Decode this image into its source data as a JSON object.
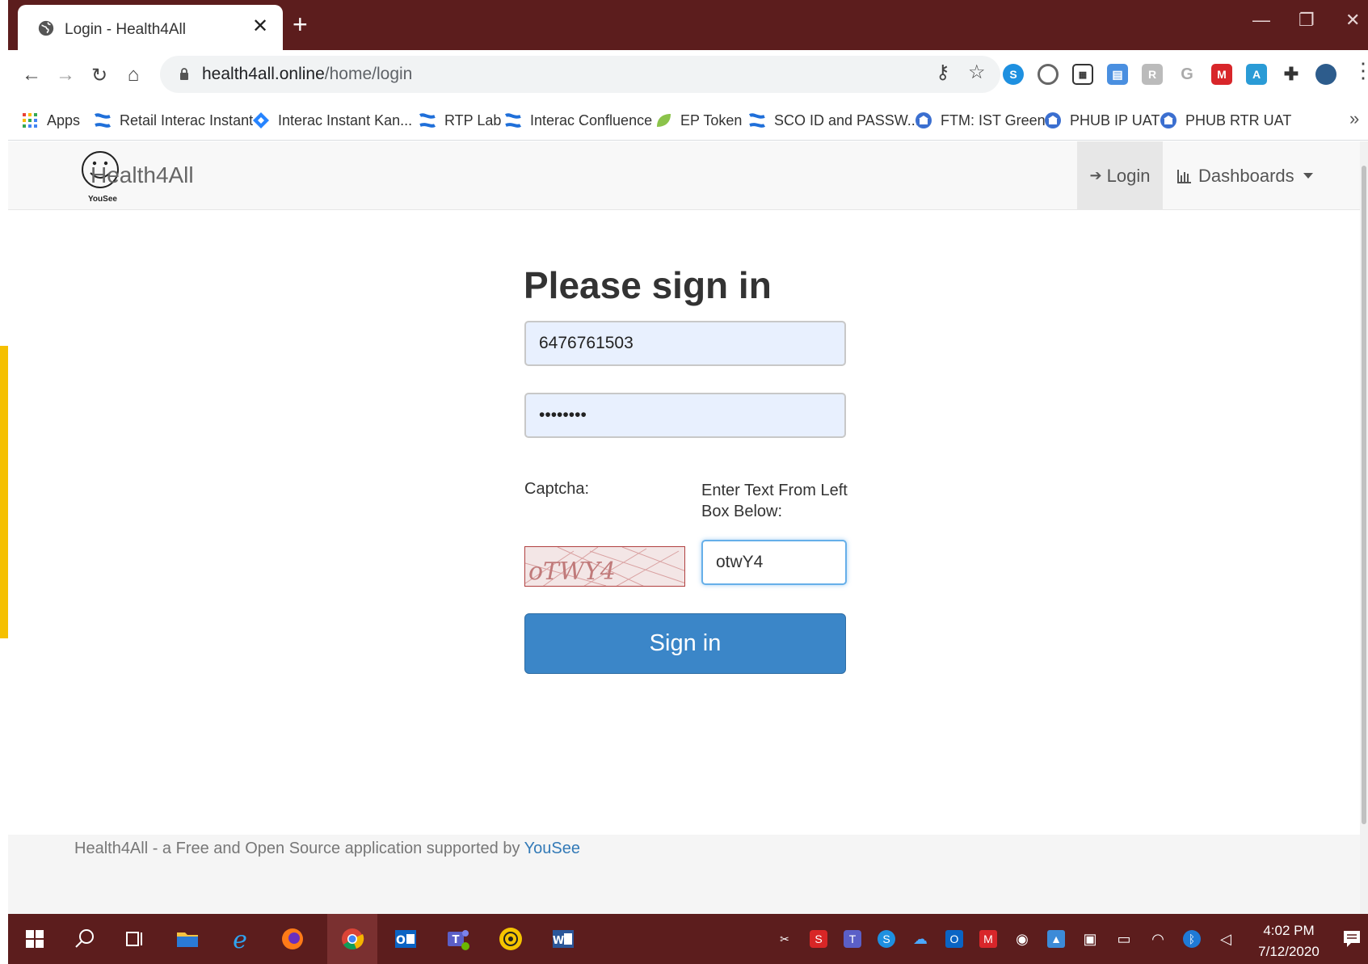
{
  "browser": {
    "tab": {
      "title": "Login - Health4All",
      "icon": "globe-icon"
    },
    "new_tab": "+",
    "window_controls": {
      "minimize": "—",
      "restore": "❐",
      "close": "✕"
    },
    "url": {
      "host": "health4all.online",
      "path": "/home/login"
    },
    "bookmarks": [
      {
        "label": "Apps",
        "icon": "apps-grid-icon"
      },
      {
        "label": "Retail Interac Instant",
        "icon": "confluence-icon"
      },
      {
        "label": "Interac Instant Kan...",
        "icon": "jira-icon"
      },
      {
        "label": "RTP Lab",
        "icon": "confluence-icon"
      },
      {
        "label": "Interac Confluence",
        "icon": "confluence-icon"
      },
      {
        "label": "EP Token",
        "icon": "leaf-icon"
      },
      {
        "label": "SCO ID and PASSW...",
        "icon": "confluence-icon"
      },
      {
        "label": "FTM: IST Green",
        "icon": "bank-icon"
      },
      {
        "label": "PHUB IP UAT",
        "icon": "bank-icon"
      },
      {
        "label": "PHUB RTR UAT",
        "icon": "bank-icon"
      }
    ],
    "bookmarks_more": "»"
  },
  "site": {
    "brand": "Health4All",
    "brand_sub": "YouSee",
    "nav": {
      "login": "Login",
      "dashboards": "Dashboards"
    }
  },
  "form": {
    "heading": "Please sign in",
    "username_value": "6476761503",
    "password_value": "••••••••",
    "captcha_label": "Captcha:",
    "enter_label": "Enter Text From Left Box Below:",
    "captcha_text": "oTWY4",
    "captcha_value": "otwY4",
    "submit": "Sign in"
  },
  "footer": {
    "text": "Health4All - a Free and Open Source application supported by ",
    "link": "YouSee"
  },
  "taskbar": {
    "time": "4:02 PM",
    "date": "7/12/2020"
  },
  "colors": {
    "titlebar": "#5c1d1d",
    "primary_button": "#3b86c8",
    "link": "#337ab7",
    "autofill_bg": "#e8f0fe"
  }
}
